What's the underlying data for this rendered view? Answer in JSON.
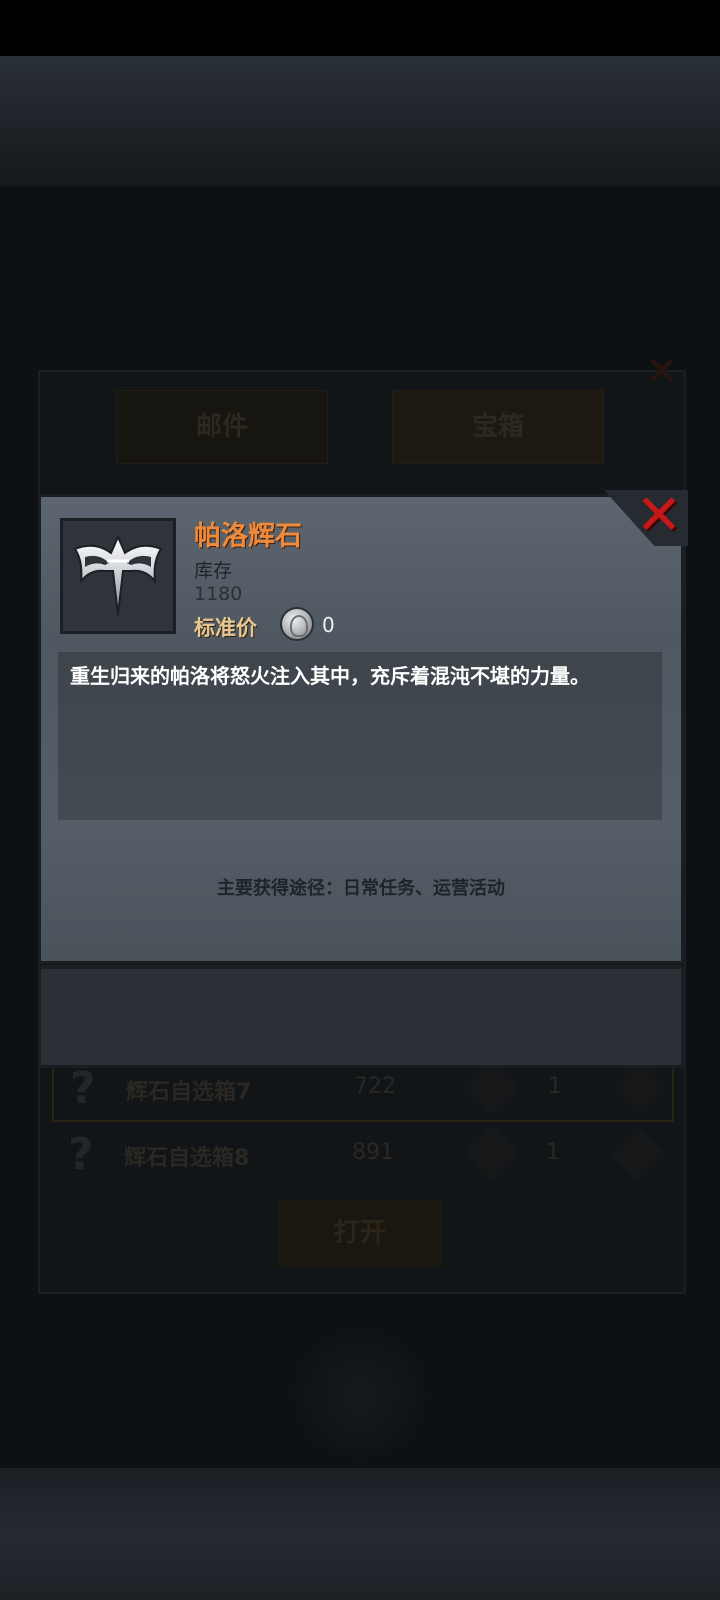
{
  "background": {
    "title": "",
    "tabs": [
      "邮件",
      "宝箱"
    ],
    "rows": [
      {
        "name": "辉石自选箱7",
        "count": "722",
        "qty": "1"
      },
      {
        "name": "辉石自选箱8",
        "count": "891",
        "qty": "1"
      }
    ],
    "open_button": "打开",
    "emblem_label": ""
  },
  "popup": {
    "item_name": "帕洛辉石",
    "stock_label": "库存",
    "stock_value": "1180",
    "price_label": "标准价",
    "price_value": "0",
    "description": "重生归来的帕洛将怒火注入其中，充斥着混沌不堪的力量。",
    "source": "主要获得途径：日常任务、运营活动",
    "close_symbol": "✕"
  },
  "icons": {
    "item_icon": "winged-emblem-icon",
    "coin_icon": "silver-coin-icon",
    "close_icon": "red-x-icon"
  },
  "colors": {
    "item_name": "#f08a3a",
    "close": "#c61818",
    "price_label": "#e8c890"
  }
}
